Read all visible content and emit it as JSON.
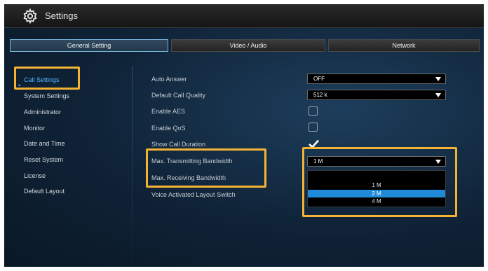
{
  "window": {
    "title": "Settings",
    "icon": "gear-icon"
  },
  "tabs": [
    {
      "label": "General Setting",
      "active": true
    },
    {
      "label": "Video / Audio",
      "active": false
    },
    {
      "label": "Network",
      "active": false
    }
  ],
  "sidebar": {
    "items": [
      {
        "label": "Call Settings",
        "active": true
      },
      {
        "label": "System Settings"
      },
      {
        "label": "Administrator"
      },
      {
        "label": "Monitor"
      },
      {
        "label": "Date and Time"
      },
      {
        "label": "Reset System"
      },
      {
        "label": "License"
      },
      {
        "label": "Default Layout"
      }
    ]
  },
  "settings": {
    "auto_answer": {
      "label": "Auto Answer",
      "value": "OFF"
    },
    "default_call_quality": {
      "label": "Default Call Quality",
      "value": "512 k"
    },
    "enable_aes": {
      "label": "Enable AES",
      "checked": false
    },
    "enable_qos": {
      "label": "Enable QoS",
      "checked": false
    },
    "show_call_duration": {
      "label": "Show Call Duration",
      "checked": true
    },
    "max_tx_bandwidth": {
      "label": "Max. Transmitting Bandwidth",
      "value": "1 M"
    },
    "max_rx_bandwidth": {
      "label": "Max. Receiving Bandwidth"
    },
    "voice_activated_layout": {
      "label": "Voice Activated Layout Switch"
    }
  },
  "dropdown": {
    "options": [
      "1 M",
      "2 M",
      "4 M"
    ],
    "selected": "2 M"
  },
  "colors": {
    "accent": "#54b6ff",
    "highlight": "#f5b335",
    "selected_option": "#1f8ad8",
    "background": "#0f2236"
  }
}
